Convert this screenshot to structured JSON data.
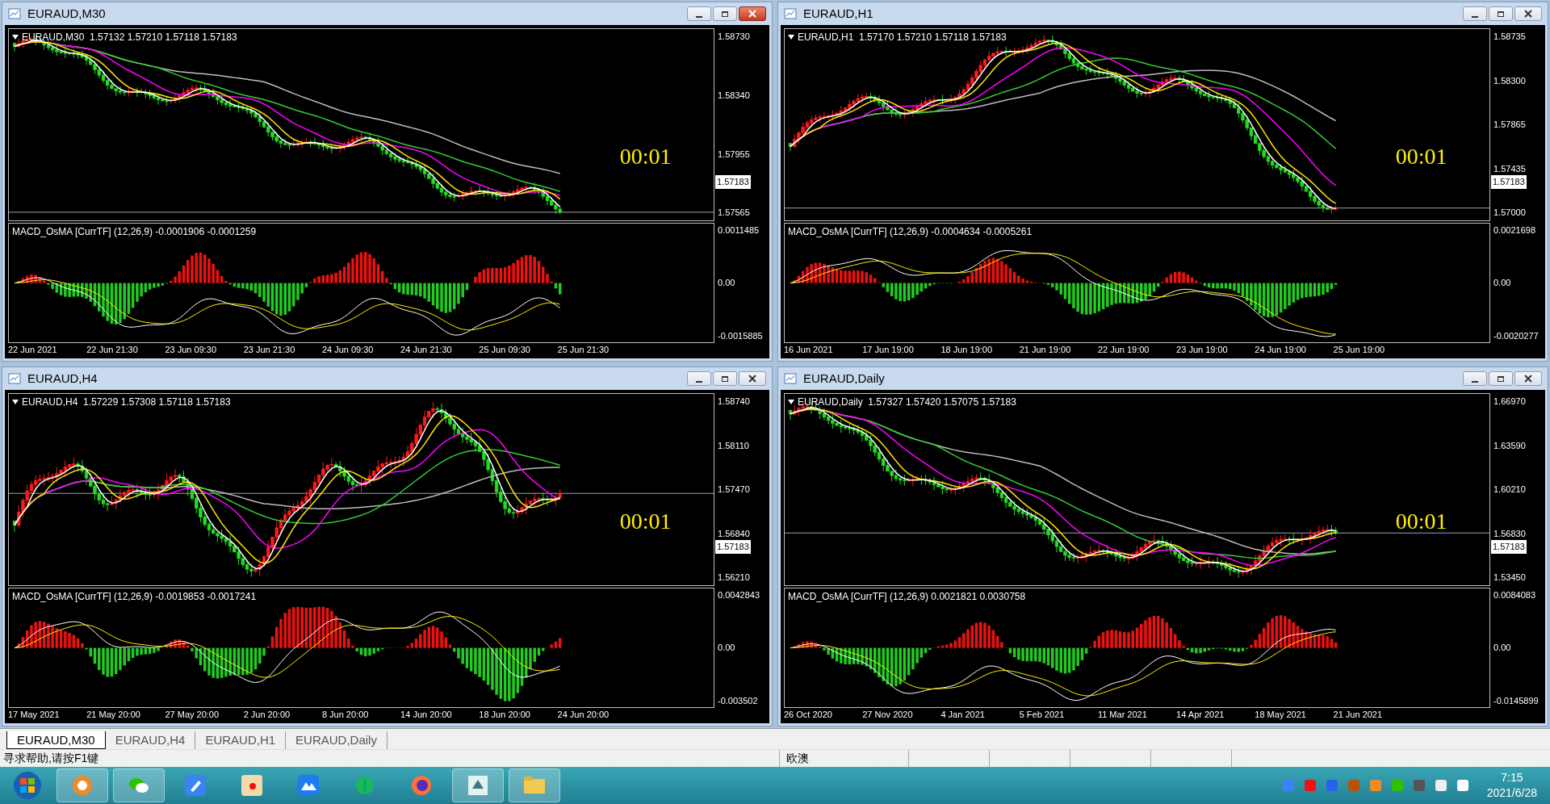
{
  "windows": [
    {
      "title": "EURAUD,M30",
      "active": true,
      "chart_header": "EURAUD,M30  1.57132 1.57210 1.57118 1.57183",
      "price_ticks": [
        "1.58730",
        "1.58340",
        "1.57955",
        "1.57565"
      ],
      "current_price": "1.57183",
      "timer": "00:01",
      "indicator_header": "MACD_OsMA [CurrTF] (12,26,9) -0.0001906 -0.0001259",
      "indicator_ticks": [
        "0.0011485",
        "0.00",
        "-0.0015885"
      ],
      "time_labels": [
        "22 Jun 2021",
        "22 Jun 21:30",
        "23 Jun 09:30",
        "23 Jun 21:30",
        "24 Jun 09:30",
        "24 Jun 21:30",
        "25 Jun 09:30",
        "25 Jun 21:30"
      ]
    },
    {
      "title": "EURAUD,H1",
      "active": false,
      "chart_header": "EURAUD,H1  1.57170 1.57210 1.57118 1.57183",
      "price_ticks": [
        "1.58735",
        "1.58300",
        "1.57865",
        "1.57435",
        "1.57000"
      ],
      "current_price": "1.57183",
      "timer": "00:01",
      "indicator_header": "MACD_OsMA [CurrTF] (12,26,9) -0.0004634 -0.0005261",
      "indicator_ticks": [
        "0.0021698",
        "0.00",
        "-0.0020277"
      ],
      "time_labels": [
        "16 Jun 2021",
        "17 Jun 19:00",
        "18 Jun 19:00",
        "21 Jun 19:00",
        "22 Jun 19:00",
        "23 Jun 19:00",
        "24 Jun 19:00",
        "25 Jun 19:00"
      ]
    },
    {
      "title": "EURAUD,H4",
      "active": false,
      "chart_header": "EURAUD,H4  1.57229 1.57308 1.57118 1.57183",
      "price_ticks": [
        "1.58740",
        "1.58110",
        "1.57470",
        "1.56840",
        "1.56210"
      ],
      "current_price": "1.57183",
      "timer": "00:01",
      "indicator_header": "MACD_OsMA [CurrTF] (12,26,9) -0.0019853 -0.0017241",
      "indicator_ticks": [
        "0.0042843",
        "0.00",
        "-0.003502"
      ],
      "time_labels": [
        "17 May 2021",
        "21 May 20:00",
        "27 May 20:00",
        "2 Jun 20:00",
        "8 Jun 20:00",
        "14 Jun 20:00",
        "18 Jun 20:00",
        "24 Jun 20:00"
      ]
    },
    {
      "title": "EURAUD,Daily",
      "active": false,
      "chart_header": "EURAUD,Daily  1.57327 1.57420 1.57075 1.57183",
      "price_ticks": [
        "1.66970",
        "1.63590",
        "1.60210",
        "1.56830",
        "1.53450"
      ],
      "current_price": "1.57183",
      "timer": "00:01",
      "indicator_header": "MACD_OsMA [CurrTF] (12,26,9) 0.0021821 0.0030758",
      "indicator_ticks": [
        "0.0084083",
        "0.00",
        "-0.0145899"
      ],
      "time_labels": [
        "26 Oct 2020",
        "27 Nov 2020",
        "4 Jan 2021",
        "5 Feb 2021",
        "11 Mar 2021",
        "14 Apr 2021",
        "18 May 2021",
        "21 Jun 2021"
      ]
    }
  ],
  "tabs": [
    {
      "label": "EURAUD,M30",
      "selected": true
    },
    {
      "label": "EURAUD,H4",
      "selected": false
    },
    {
      "label": "EURAUD,H1",
      "selected": false
    },
    {
      "label": "EURAUD,Daily",
      "selected": false
    }
  ],
  "status_bar": {
    "help": "寻求帮助,请按F1键",
    "profile": "欧澳"
  },
  "clock": {
    "time": "7:15",
    "date": "2021/6/28"
  }
}
